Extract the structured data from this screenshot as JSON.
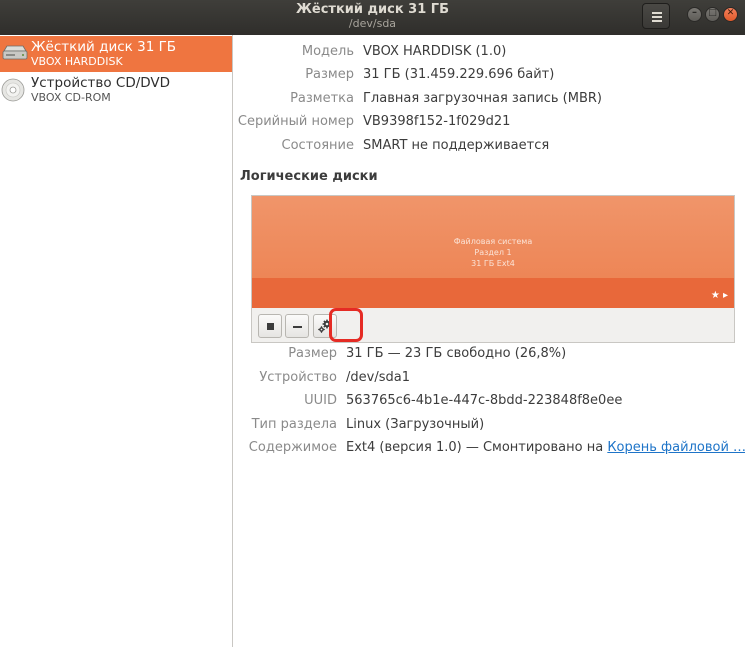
{
  "window": {
    "title": "Жёсткий диск 31 ГБ",
    "subtitle": "/dev/sda"
  },
  "sidebar": {
    "drives": [
      {
        "name": "Жёсткий диск 31 ГБ",
        "model": "VBOX HARDDISK",
        "icon": "hard-disk-icon",
        "selected": true
      },
      {
        "name": "Устройство CD/DVD",
        "model": "VBOX CD-ROM",
        "icon": "optical-disc-icon",
        "selected": false
      }
    ]
  },
  "disk_info": [
    {
      "label": "Модель",
      "value": "VBOX HARDDISK (1.0)"
    },
    {
      "label": "Размер",
      "value": "31 ГБ (31.459.229.696 байт)"
    },
    {
      "label": "Разметка",
      "value": "Главная загрузочная запись (MBR)"
    },
    {
      "label": "Серийный номер",
      "value": "VB9398f152-1f029d21"
    },
    {
      "label": "Состояние",
      "value": "SMART не поддерживается"
    }
  ],
  "volumes": {
    "title": "Логические диски",
    "partition": {
      "line1": "Файловая система",
      "line2": "Раздел 1",
      "line3": "31 ГБ Ext4",
      "flags": "★ ▸"
    },
    "highlight_color": "#e52b24"
  },
  "partition_info": [
    {
      "label": "Размер",
      "value": "31 ГБ — 23 ГБ свободно (26,8%)"
    },
    {
      "label": "Устройство",
      "value": "/dev/sda1"
    },
    {
      "label": "UUID",
      "value": "563765c6-4b1e-447c-8bdd-223848f8e0ee"
    },
    {
      "label": "Тип раздела",
      "value": "Linux (Загрузочный)"
    },
    {
      "label": "Содержимое",
      "value": "Ext4 (версия 1.0) — Смонтировано на ",
      "link": "Корень файловой …"
    }
  ],
  "colors": {
    "accent": "#ef7540",
    "partition": "#ec804f",
    "link": "#1e74c8"
  }
}
